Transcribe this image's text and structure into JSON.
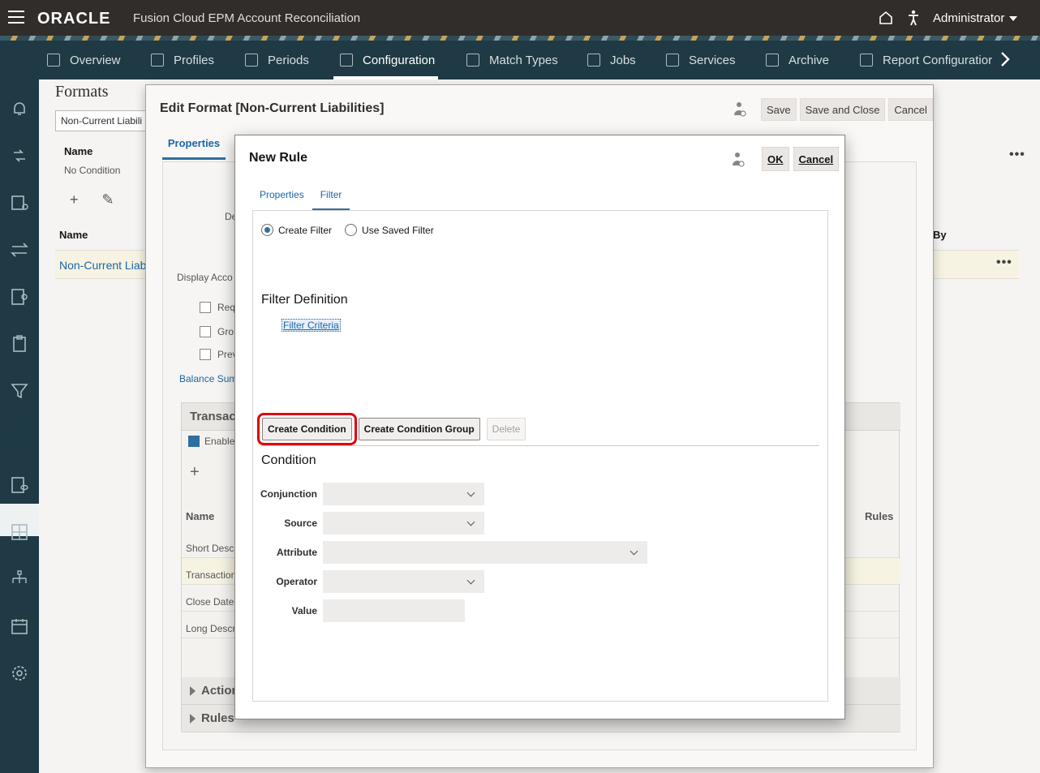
{
  "header": {
    "brand": "ORACLE",
    "app_title": "Fusion Cloud EPM Account Reconciliation",
    "user": "Administrator"
  },
  "nav": {
    "tabs": [
      "Overview",
      "Profiles",
      "Periods",
      "Configuration",
      "Match Types",
      "Jobs",
      "Services",
      "Archive",
      "Report Configuratior"
    ],
    "active": "Configuration"
  },
  "background": {
    "title": "Formats",
    "search_value": "Non-Current Liabili",
    "name_header": "Name",
    "no_condition": "No Condition",
    "list_name_header": "Name",
    "row_name": "Non-Current Liab",
    "by_header": "By"
  },
  "edit_format": {
    "title": "Edit Format [Non-Current Liabilities]",
    "save": "Save",
    "save_close": "Save and Close",
    "cancel": "Cancel",
    "tab": "Properties",
    "desc_label": "De",
    "display_label": "Display Acco",
    "check1": "Req",
    "check2": "Gro",
    "check3": "Prev",
    "balance_link": "Balance Sum",
    "section_transact": "Transact",
    "enable_label": "Enable",
    "col_name": "Name",
    "col_rules": "Rules",
    "rows": [
      "Short Desc",
      "Transaction",
      "Close Date",
      "Long Descr"
    ],
    "section_actions": "Action",
    "section_rules": "Rules"
  },
  "new_rule": {
    "title": "New Rule",
    "ok": "OK",
    "cancel": "Cancel",
    "tabs": [
      "Properties",
      "Filter"
    ],
    "active_tab": "Filter",
    "radio_create": "Create Filter",
    "radio_saved": "Use Saved Filter",
    "filter_definition": "Filter Definition",
    "filter_criteria": "Filter Criteria",
    "btn_create_condition": "Create Condition",
    "btn_create_group": "Create Condition Group",
    "btn_delete": "Delete",
    "condition_title": "Condition",
    "fields": {
      "conjunction": "Conjunction",
      "source": "Source",
      "attribute": "Attribute",
      "operator": "Operator",
      "value": "Value"
    }
  }
}
